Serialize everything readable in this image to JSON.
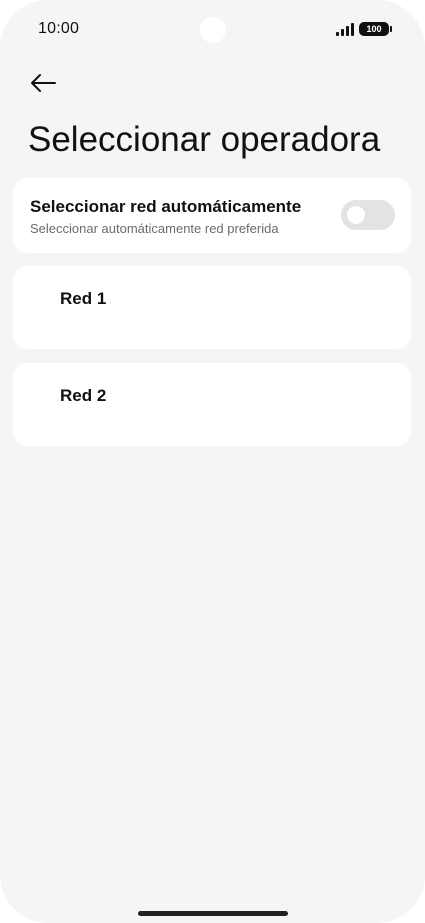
{
  "status_bar": {
    "time": "10:00",
    "battery": "100",
    "signal_icon": "cellular-signal-icon"
  },
  "header": {
    "back_icon": "arrow-left-icon",
    "title": "Seleccionar operadora"
  },
  "auto_select": {
    "title": "Seleccionar red automáticamente",
    "subtitle": "Seleccionar automáticamente red preferida",
    "toggle_on": false
  },
  "networks": [
    {
      "label": "Red 1"
    },
    {
      "label": "Red 2"
    }
  ],
  "colors": {
    "background": "#f5f5f5",
    "card": "#ffffff",
    "toggle_off": "#e3e3e3",
    "text_primary": "#111111",
    "text_secondary": "#6b6b6b"
  }
}
